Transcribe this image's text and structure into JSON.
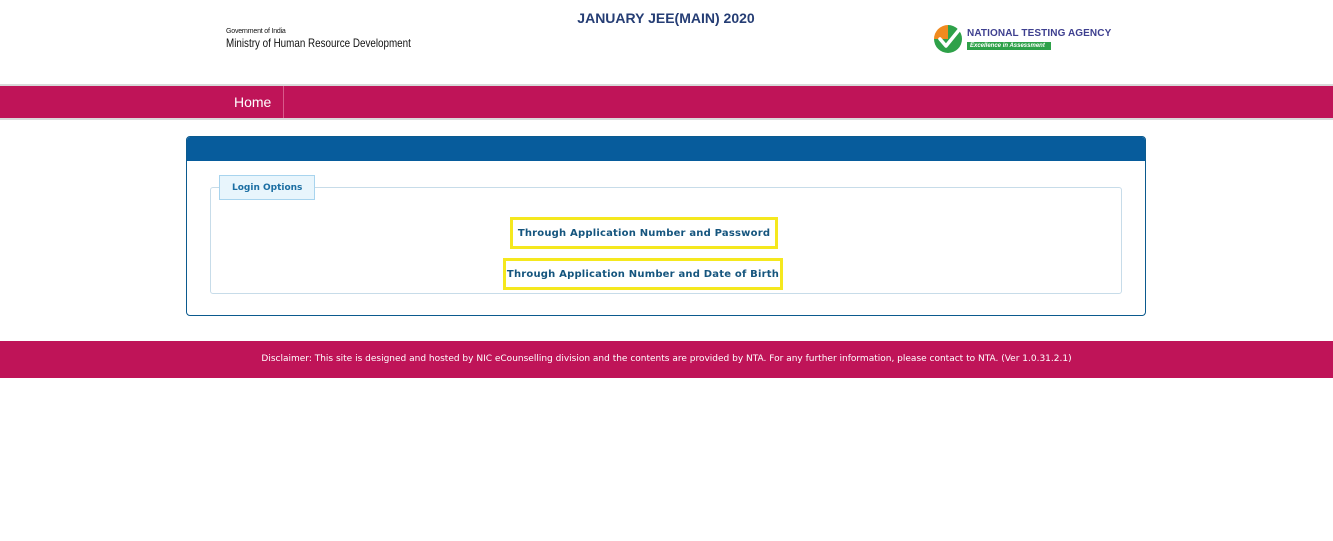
{
  "header": {
    "gov_line": "Government of India",
    "ministry": "Ministry of Human Resource Development",
    "title": "JANUARY JEE(MAIN) 2020",
    "nta_name": "NATIONAL TESTING AGENCY",
    "nta_tagline": "Excellence in Assessment",
    "icons": {
      "emblem": "national-emblem-icon",
      "nta_mark": "checkmark-circle-logo-icon"
    }
  },
  "nav": {
    "home_label": "Home"
  },
  "login": {
    "legend": "Login Options",
    "option_password": "Through Application Number and Password",
    "option_dob": "Through Application Number and Date of Birth"
  },
  "footer": {
    "disclaimer": "Disclaimer: This site is designed and hosted by NIC eCounselling division and the contents are provided by NTA. For any further information, please contact to NTA. (Ver 1.0.31.2.1)"
  },
  "colors": {
    "brand_magenta": "#bf1458",
    "panel_blue": "#075c9c",
    "highlight_yellow": "#f5e81e",
    "title_navy": "#253d74",
    "nta_green": "#2ea149",
    "nta_orange": "#f08a1f"
  }
}
